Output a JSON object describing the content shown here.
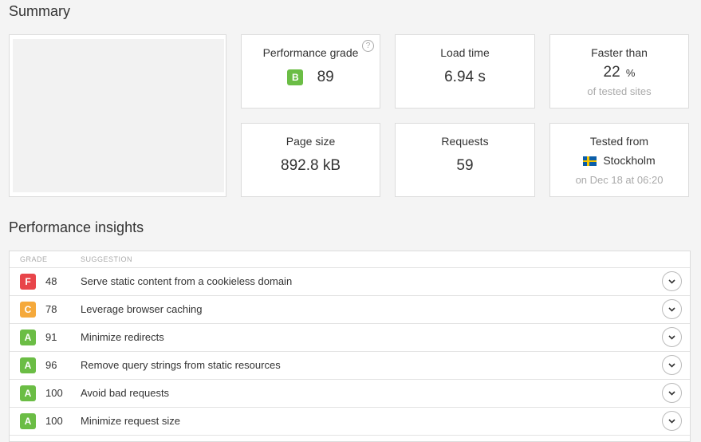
{
  "summary": {
    "title": "Summary",
    "performance_grade": {
      "title": "Performance grade",
      "grade": "B",
      "grade_color": "#6bbd45",
      "value": "89",
      "help": "?"
    },
    "load_time": {
      "title": "Load time",
      "value": "6.94 s"
    },
    "faster_than": {
      "title": "Faster than",
      "value": "22",
      "unit": "%",
      "sub": "of tested sites"
    },
    "page_size": {
      "title": "Page size",
      "value": "892.8 kB"
    },
    "requests": {
      "title": "Requests",
      "value": "59"
    },
    "tested_from": {
      "title": "Tested from",
      "location": "Stockholm",
      "flag": "sweden-flag-icon",
      "date": "on Dec 18 at 06:20"
    }
  },
  "insights": {
    "title": "Performance insights",
    "headers": {
      "grade": "GRADE",
      "suggestion": "SUGGESTION"
    },
    "rows": [
      {
        "grade": "F",
        "color": "#e8454a",
        "score": "48",
        "suggestion": "Serve static content from a cookieless domain"
      },
      {
        "grade": "C",
        "color": "#f5a93b",
        "score": "78",
        "suggestion": "Leverage browser caching"
      },
      {
        "grade": "A",
        "color": "#6bbd45",
        "score": "91",
        "suggestion": "Minimize redirects"
      },
      {
        "grade": "A",
        "color": "#6bbd45",
        "score": "96",
        "suggestion": "Remove query strings from static resources"
      },
      {
        "grade": "A",
        "color": "#6bbd45",
        "score": "100",
        "suggestion": "Avoid bad requests"
      },
      {
        "grade": "A",
        "color": "#6bbd45",
        "score": "100",
        "suggestion": "Minimize request size"
      }
    ]
  }
}
